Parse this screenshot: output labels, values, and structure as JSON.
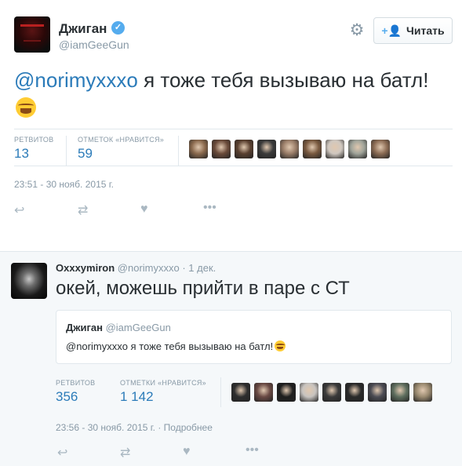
{
  "tweet1": {
    "author_name": "Джиган",
    "author_handle": "@iamGeeGun",
    "follow_label": "Читать",
    "text_mention": "@norimyxxxo",
    "text_body": " я тоже тебя вызываю на батл!",
    "retweets_label": "РЕТВИТОВ",
    "retweets_count": "13",
    "likes_label": "ОТМЕТОК «НРАВИТСЯ»",
    "likes_count": "59",
    "timestamp": "23:51 - 30 нояб. 2015 г.",
    "liker_avatars": [
      "#8b6a4e",
      "#6b4b3a",
      "#5a4030",
      "#3b3b3b",
      "#9a7d68",
      "#7a5a40",
      "#d0c8c0",
      "#a0a49a",
      "#8c6c54"
    ]
  },
  "tweet2": {
    "author_name": "Oxxxymiron",
    "author_handle": "@norimyxxxo",
    "date": "· 1 дек.",
    "text": "окей, можешь прийти в паре с СТ",
    "quote": {
      "author_name": "Джиган",
      "author_handle": "@iamGeeGun",
      "text": "@norimyxxxo я тоже тебя вызываю на батл!"
    },
    "retweets_label": "РЕТВИТОВ",
    "retweets_count": "356",
    "likes_label": "ОТМЕТКИ «НРАВИТСЯ»",
    "likes_count": "1 142",
    "timestamp": "23:56 - 30 нояб. 2015 г. · Подробнее",
    "liker_avatars": [
      "#2e2e2e",
      "#6a4a44",
      "#1e1e1e",
      "#c8c4c0",
      "#3a3a3a",
      "#2a2a2a",
      "#4c4c54",
      "#5e6e5e",
      "#9a8a70"
    ]
  },
  "colors": {
    "link": "#2b7bb9",
    "muted": "#8899a6",
    "text": "#292f33",
    "verified": "#55acee"
  }
}
